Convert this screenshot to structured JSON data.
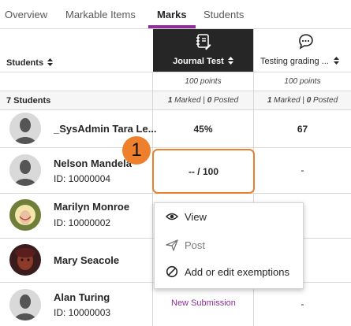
{
  "tabs": [
    {
      "label": "Overview"
    },
    {
      "label": "Markable Items"
    },
    {
      "label": "Marks"
    },
    {
      "label": "Students"
    }
  ],
  "table": {
    "students_header": "Students",
    "sort_icon": "sort-icon",
    "columns": [
      {
        "title": "Journal Test",
        "icon": "journal-icon",
        "points": "100 points",
        "marked_count": "1",
        "posted_count": "0"
      },
      {
        "title": "Testing grading ...",
        "icon": "discussion-icon",
        "points": "100 points",
        "marked_count": "1",
        "posted_count": "0"
      }
    ],
    "marked_label": "Marked",
    "posted_label": "Posted",
    "separator": "|",
    "student_count": "7 Students",
    "rows": [
      {
        "name": "_SysAdmin Tara Le...",
        "id": "",
        "col1": "45%",
        "col2": "67"
      },
      {
        "name": "Nelson Mandela",
        "id": "ID: 10000004",
        "col1": "-- / 100",
        "col2": "-"
      },
      {
        "name": "Marilyn Monroe",
        "id": "ID: 10000002",
        "col1": "",
        "col2": ""
      },
      {
        "name": "Mary Seacole",
        "id": "",
        "col1": "",
        "col2": ""
      },
      {
        "name": "Alan Turing",
        "id": "ID: 10000003",
        "col1": "New Submission",
        "col2": "-"
      }
    ]
  },
  "callout": {
    "number": "1",
    "color": "#ee7f2d"
  },
  "context_menu": {
    "items": [
      {
        "label": "View",
        "icon": "eye-icon"
      },
      {
        "label": "Post",
        "icon": "send-icon"
      },
      {
        "label": "Add or edit exemptions",
        "icon": "exemption-icon"
      }
    ]
  },
  "colors": {
    "accent": "#8c2f96",
    "header_dark": "#262626",
    "highlight": "#e9802f"
  }
}
